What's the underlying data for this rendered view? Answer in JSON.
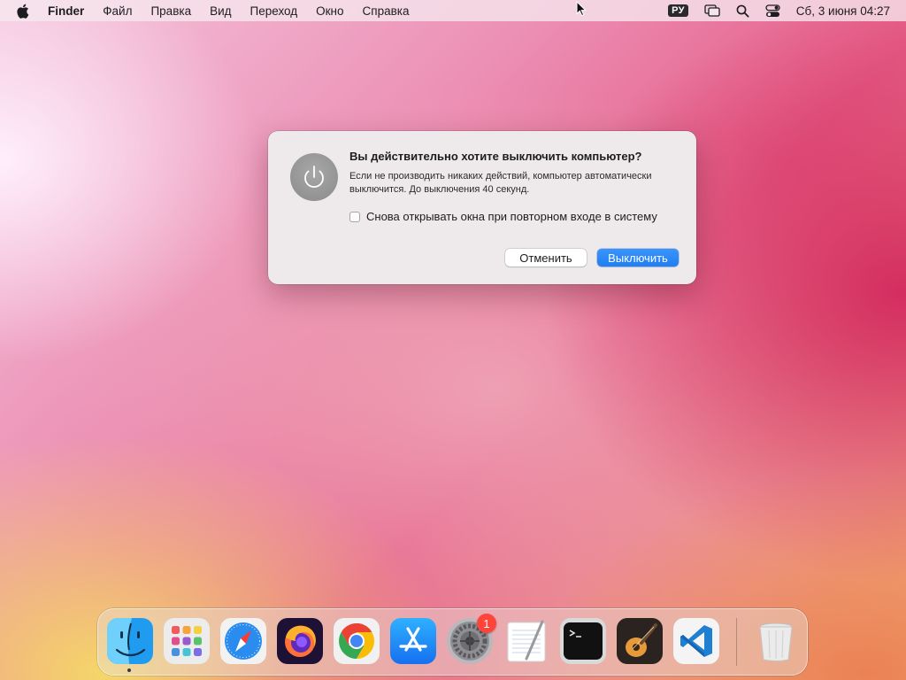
{
  "menubar": {
    "app_name": "Finder",
    "items": [
      "Файл",
      "Правка",
      "Вид",
      "Переход",
      "Окно",
      "Справка"
    ],
    "input_source": "РУ",
    "clock": "Сб, 3 июня  04:27"
  },
  "dialog": {
    "title": "Вы действительно хотите выключить компьютер?",
    "message": "Если не производить никаких действий, компьютер автоматически выключится. До выключения 40 секунд.",
    "checkbox_label": "Снова открывать окна при повторном входе в систему",
    "checkbox_checked": false,
    "cancel_label": "Отменить",
    "confirm_label": "Выключить",
    "accent": "#1f7ff2"
  },
  "dock": {
    "apps": [
      "finder",
      "launchpad",
      "safari",
      "firefox",
      "chrome",
      "app-store",
      "system-preferences",
      "textedit",
      "terminal",
      "garageband",
      "vscode",
      "trash"
    ],
    "system_preferences_badge": "1"
  }
}
